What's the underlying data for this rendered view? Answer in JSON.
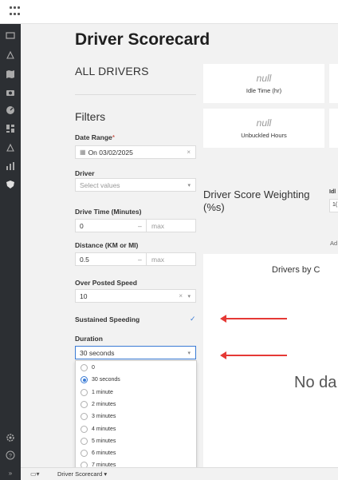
{
  "app": {
    "title": "Driver Scorecard"
  },
  "header": {
    "subtitle": "ALL DRIVERS"
  },
  "filters": {
    "title": "Filters",
    "date_range": {
      "label": "Date Range",
      "required_mark": "*",
      "value": "On 03/02/2025",
      "clear": "×"
    },
    "driver": {
      "label": "Driver",
      "placeholder": "Select values"
    },
    "drive_time": {
      "label": "Drive Time (Minutes)",
      "min": "0",
      "dash": "–",
      "max_placeholder": "max"
    },
    "distance": {
      "label": "Distance (KM or MI)",
      "min": "0.5",
      "dash": "–",
      "max_placeholder": "max"
    },
    "over_posted_speed": {
      "label": "Over Posted Speed",
      "value": "10",
      "clear": "×"
    },
    "sustained_speeding": {
      "label": "Sustained Speeding",
      "checked_mark": "✓"
    },
    "duration": {
      "label": "Duration",
      "value": "30 seconds",
      "options": [
        "0",
        "30 seconds",
        "1 minute",
        "2 minutes",
        "3 minutes",
        "4 minutes",
        "5 minutes",
        "6 minutes",
        "7 minutes"
      ],
      "selected": "30 seconds"
    }
  },
  "metrics": [
    {
      "value": "null",
      "label": "Idle Time (hr)"
    },
    {
      "value": "null",
      "label": "Unbuckled Hours"
    }
  ],
  "weighting": {
    "title": "Driver Score Weighting (%s)",
    "idle_label": "Idl",
    "idle_value": "1(",
    "ad_label": "Ad"
  },
  "chart": {
    "title": "Drivers by C",
    "no_data": "No da"
  },
  "bottom_tab": {
    "label": "Driver Scorecard",
    "caret": "▾"
  },
  "colors": {
    "accent": "#3a7bd5",
    "arrow": "#e53935",
    "sidebar": "#2c2f33"
  }
}
